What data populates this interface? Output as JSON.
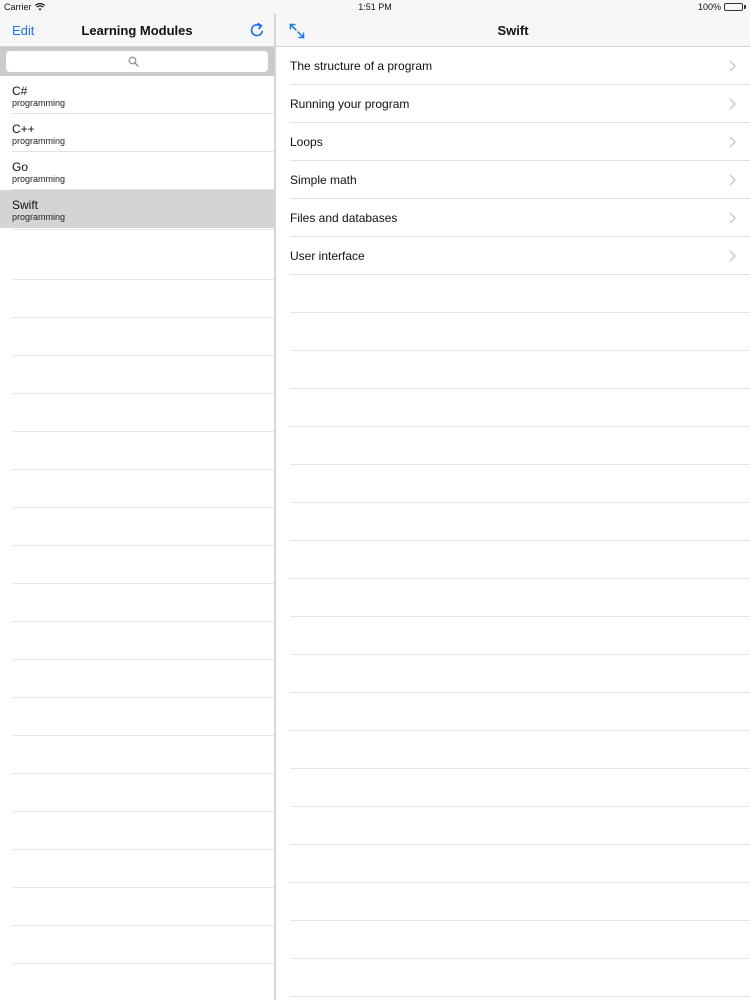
{
  "status_bar": {
    "carrier": "Carrier",
    "time": "1:51 PM",
    "battery": "100%",
    "battery_color": "#4cd964"
  },
  "master": {
    "title": "Learning Modules",
    "edit_label": "Edit",
    "refresh_icon": "refresh-icon",
    "search_icon": "search-icon",
    "modules": [
      {
        "name": "C#",
        "subtitle": "programming"
      },
      {
        "name": "C++",
        "subtitle": "programming"
      },
      {
        "name": "Go",
        "subtitle": "programming"
      },
      {
        "name": "Swift",
        "subtitle": "programming",
        "selected": true
      }
    ]
  },
  "detail": {
    "title": "Swift",
    "expand_icon": "expand-icon",
    "topics": [
      {
        "label": "The structure of a program"
      },
      {
        "label": "Running your program"
      },
      {
        "label": "Loops"
      },
      {
        "label": "Simple math"
      },
      {
        "label": "Files and databases"
      },
      {
        "label": "User interface"
      }
    ]
  },
  "colors": {
    "accent": "#1a73e8",
    "selection": "#d4d4d6",
    "navbar": "#f7f7f7"
  }
}
